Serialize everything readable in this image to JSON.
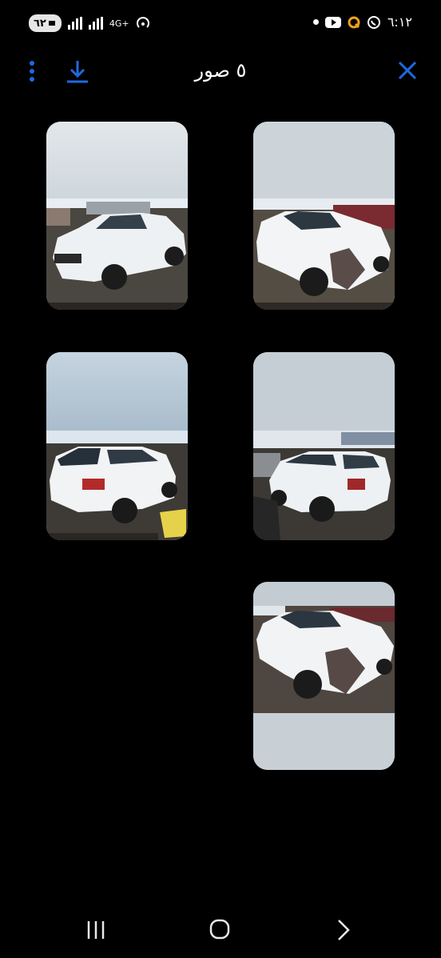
{
  "status_bar": {
    "battery": "٦٢",
    "network": "4G+",
    "time": "٦:١٢",
    "icons": [
      "signal-icon",
      "signal-icon",
      "hotspot-icon",
      "dot-icon",
      "youtube-icon",
      "q-app-icon",
      "whatsapp-icon"
    ]
  },
  "header": {
    "title": "٥ صور",
    "icons": {
      "menu": "more-vert-icon",
      "download": "download-icon",
      "close": "close-icon"
    },
    "accent": "#1e6ae0"
  },
  "gallery": {
    "photos": [
      {
        "view": "front-left, undamaged side"
      },
      {
        "view": "front-right, damaged front"
      },
      {
        "view": "rear-left"
      },
      {
        "view": "rear-right"
      },
      {
        "view": "front-right, damaged front (close)"
      }
    ]
  },
  "nav": {
    "icons": [
      "recent-apps-icon",
      "home-icon",
      "back-icon"
    ]
  }
}
